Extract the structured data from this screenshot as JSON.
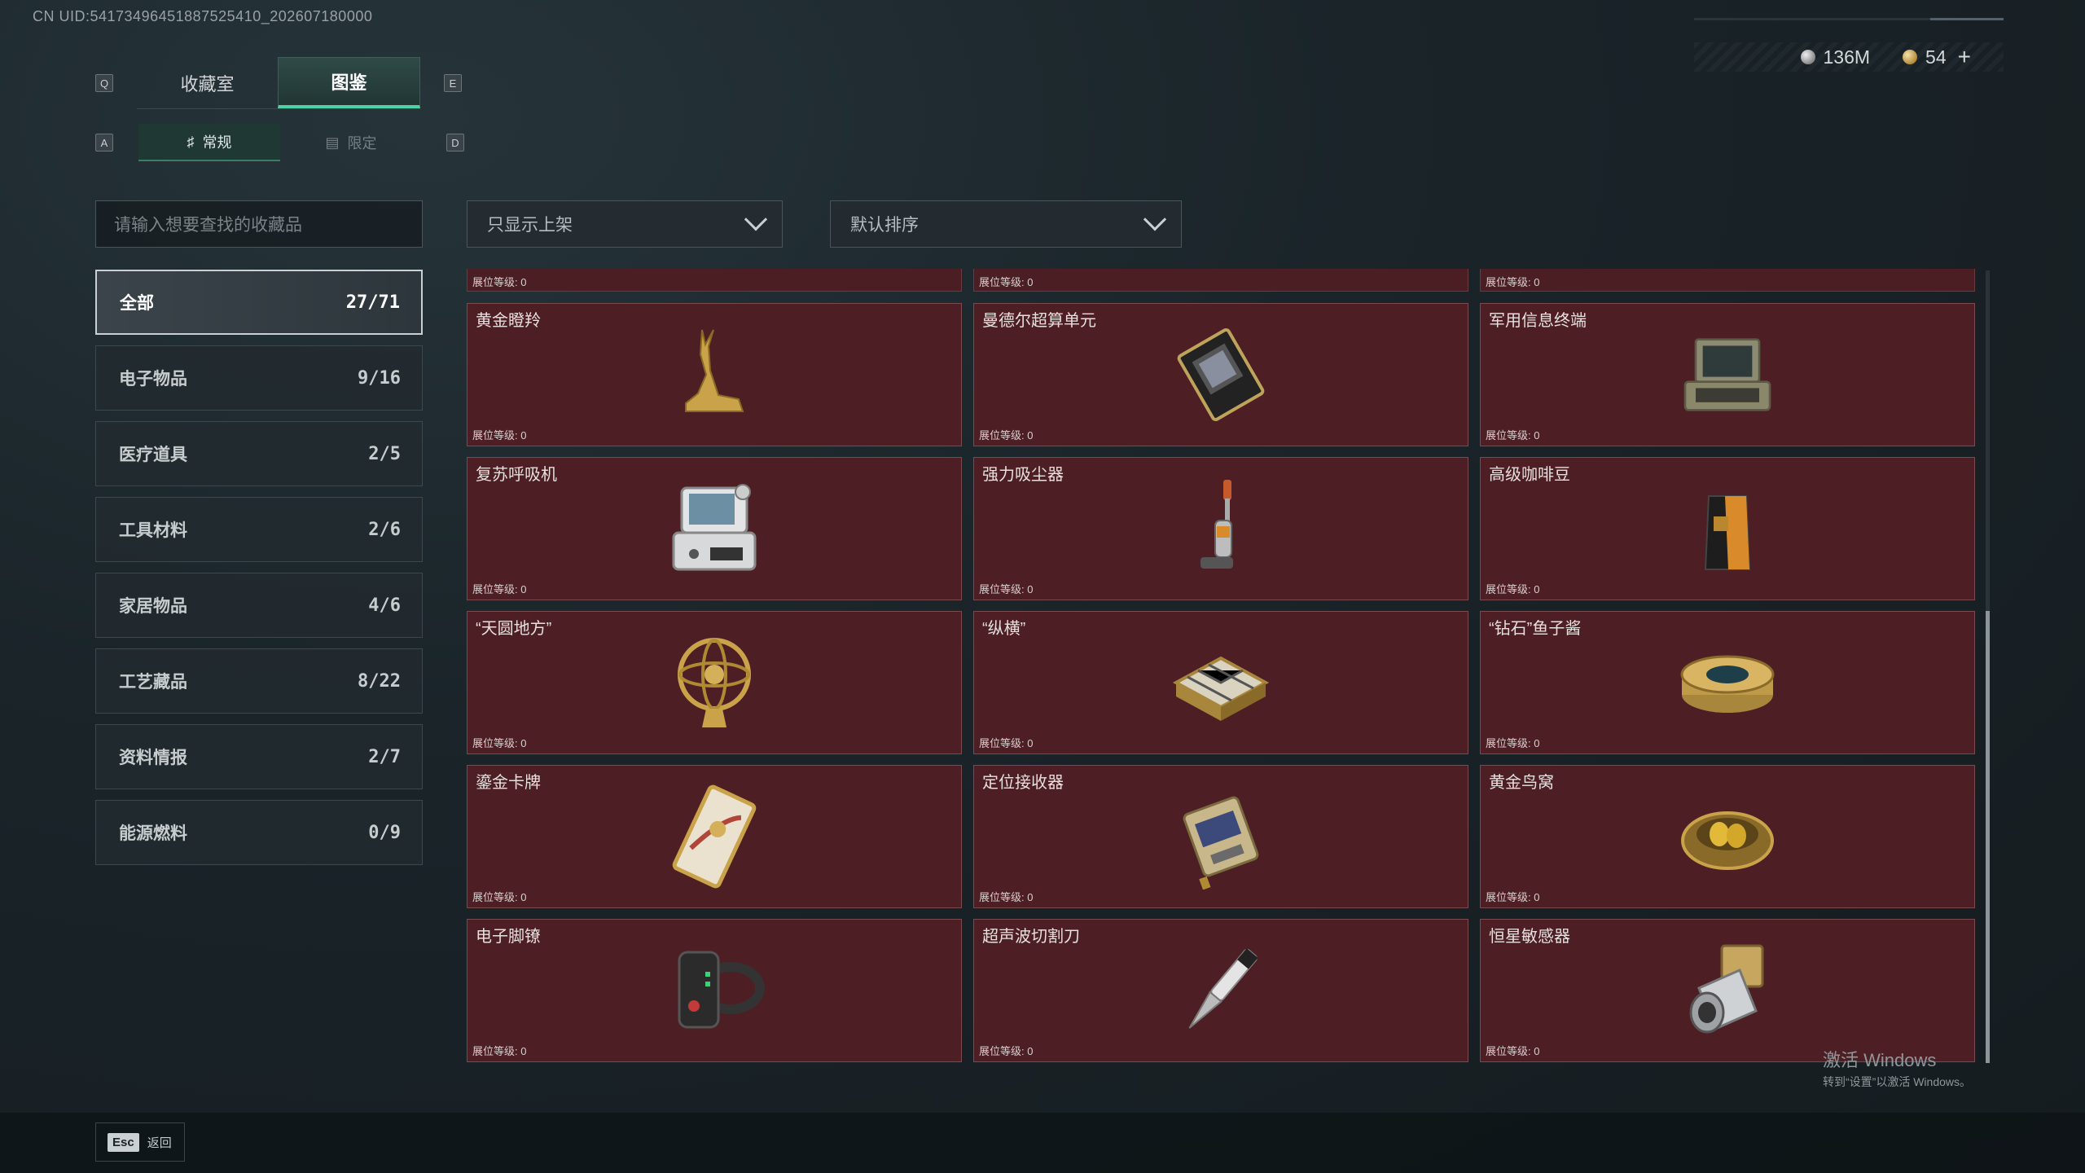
{
  "uid": "CN UID:54173496451887525410_202607180000",
  "currency": {
    "silver": "136M",
    "gold": "54",
    "add": "+"
  },
  "keys": {
    "q": "Q",
    "e": "E",
    "a": "A",
    "d": "D"
  },
  "tabs": [
    {
      "label": "收藏室"
    },
    {
      "label": "图鉴"
    }
  ],
  "subtabs": [
    {
      "label": "常规"
    },
    {
      "label": "限定"
    }
  ],
  "search": {
    "placeholder": "请输入想要查找的收藏品"
  },
  "filters": {
    "shelf": "只显示上架",
    "sort": "默认排序"
  },
  "categories": [
    {
      "label": "全部",
      "count": "27/71"
    },
    {
      "label": "电子物品",
      "count": "9/16"
    },
    {
      "label": "医疗道具",
      "count": "2/5"
    },
    {
      "label": "工具材料",
      "count": "2/6"
    },
    {
      "label": "家居物品",
      "count": "4/6"
    },
    {
      "label": "工艺藏品",
      "count": "8/22"
    },
    {
      "label": "资料情报",
      "count": "2/7"
    },
    {
      "label": "能源燃料",
      "count": "0/9"
    }
  ],
  "level_label": "展位等级: 0",
  "items": [
    {
      "name": "黄金瞪羚",
      "icon": "golden-gazelle-icon"
    },
    {
      "name": "曼德尔超算单元",
      "icon": "supercomputer-unit-icon"
    },
    {
      "name": "军用信息终端",
      "icon": "military-terminal-icon"
    },
    {
      "name": "复苏呼吸机",
      "icon": "ventilator-icon"
    },
    {
      "name": "强力吸尘器",
      "icon": "vacuum-cleaner-icon"
    },
    {
      "name": "高级咖啡豆",
      "icon": "coffee-beans-icon"
    },
    {
      "name": "“天圆地方”",
      "icon": "armillary-sphere-icon"
    },
    {
      "name": "“纵横”",
      "icon": "chess-board-icon"
    },
    {
      "name": "“钻石”鱼子酱",
      "icon": "caviar-tin-icon"
    },
    {
      "name": "鎏金卡牌",
      "icon": "gilded-card-icon"
    },
    {
      "name": "定位接收器",
      "icon": "gps-receiver-icon"
    },
    {
      "name": "黄金鸟窝",
      "icon": "golden-nest-icon"
    },
    {
      "name": "电子脚镣",
      "icon": "ankle-monitor-icon"
    },
    {
      "name": "超声波切割刀",
      "icon": "ultrasonic-cutter-icon"
    },
    {
      "name": "恒星敏感器",
      "icon": "star-sensor-icon"
    }
  ],
  "watermark": {
    "line1": "激活 Windows",
    "line2": "转到“设置”以激活 Windows。"
  },
  "footer": {
    "esc_key": "Esc",
    "back_label": "返回"
  }
}
